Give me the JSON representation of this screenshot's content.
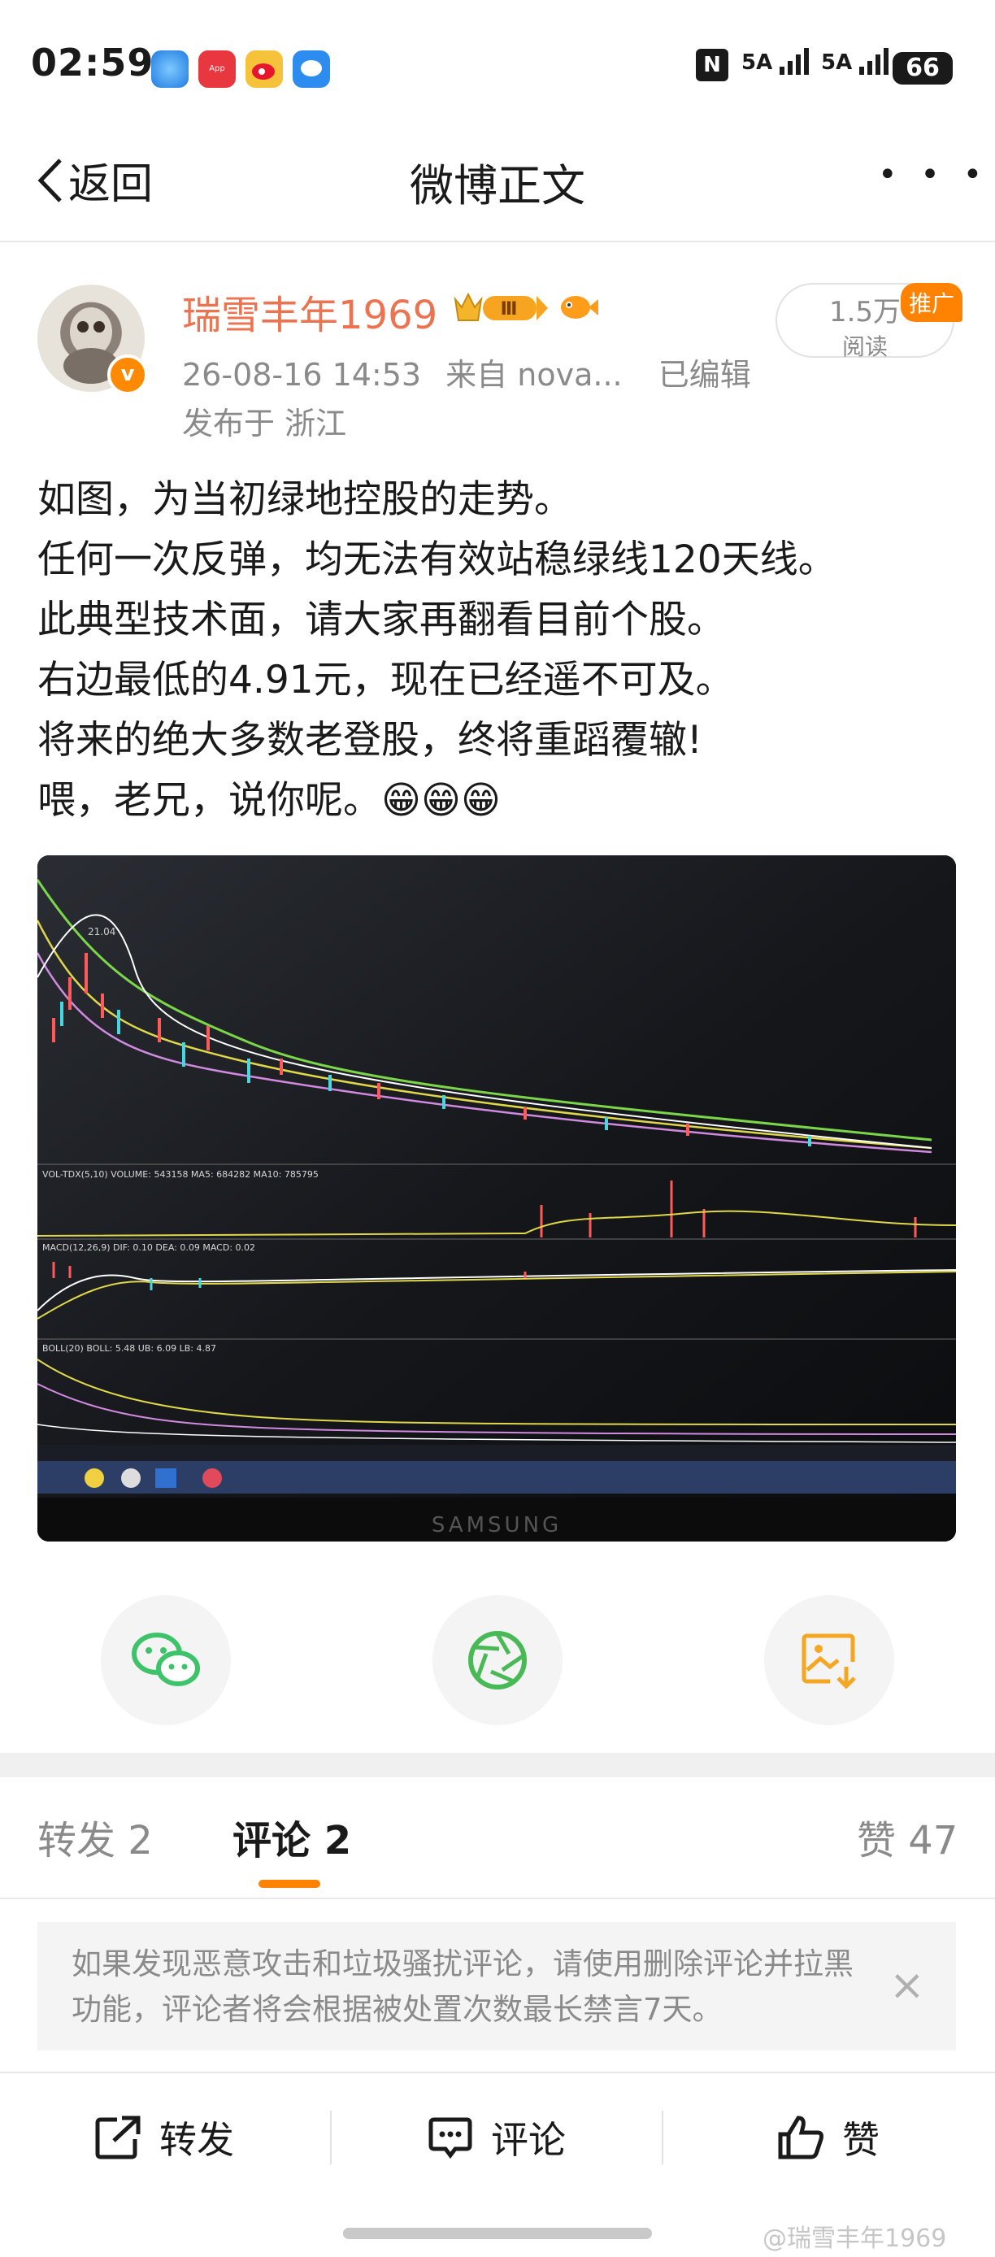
{
  "status_bar": {
    "time": "02:59",
    "app_icons": [
      "browser-icon",
      "app-gallery-icon",
      "weibo-icon",
      "message-icon"
    ],
    "app_gallery_label": "App Gallery",
    "nfc": "N",
    "sim1": "5A",
    "sim2": "5A",
    "battery": "66"
  },
  "header": {
    "back_label": "返回",
    "title": "微博正文",
    "more": "• • •"
  },
  "post": {
    "author": "瑞雪丰年1969",
    "vip_level": "Ⅲ",
    "timestamp": "26-08-16 14:53",
    "source": "来自 nova...",
    "edited": "已编辑",
    "location": "发布于 浙江",
    "reads_count": "1.5万",
    "reads_label": "阅读",
    "promote_label": "推广",
    "lines": [
      "如图，为当初绿地控股的走势。",
      "任何一次反弹，均无法有效站稳绿线120天线。",
      "此典型技术面，请大家再翻看目前个股。",
      "右边最低的4.91元，现在已经遥不可及。",
      "将来的绝大多数老登股，终将重蹈覆辙!",
      "喂，老兄，说你呢。"
    ],
    "emoji": "😁😁😁"
  },
  "photo": {
    "price_label_high": "21.04",
    "vol_label": "VOL-TDX(5,10) VOLUME: 543158 MA5: 684282 MA10: 785795",
    "macd_label": "MACD(12,26,9) DIF: 0.10 DEA: 0.09 MACD: 0.02",
    "boll_label": "BOLL(20) BOLL: 5.48 UB: 6.09 LB: 4.87",
    "brand": "SAMSUNG"
  },
  "share": {
    "icons": [
      "wechat-icon",
      "moments-icon",
      "save-image-icon"
    ]
  },
  "tabs": {
    "repost": "转发 2",
    "comment": "评论 2",
    "like": "赞 47"
  },
  "notice": {
    "text": "如果发现恶意攻击和垃圾骚扰评论，请使用删除评论并拉黑功能，评论者将会根据被处置次数最长禁言7天。",
    "close": "×"
  },
  "actions": {
    "repost": "转发",
    "comment": "评论",
    "like": "赞"
  },
  "watermark": "@瑞雪丰年1969",
  "colors": {
    "accent": "#ff8200",
    "author": "#eb7350",
    "wechat": "#3ec26a",
    "moments": "#49b955"
  }
}
